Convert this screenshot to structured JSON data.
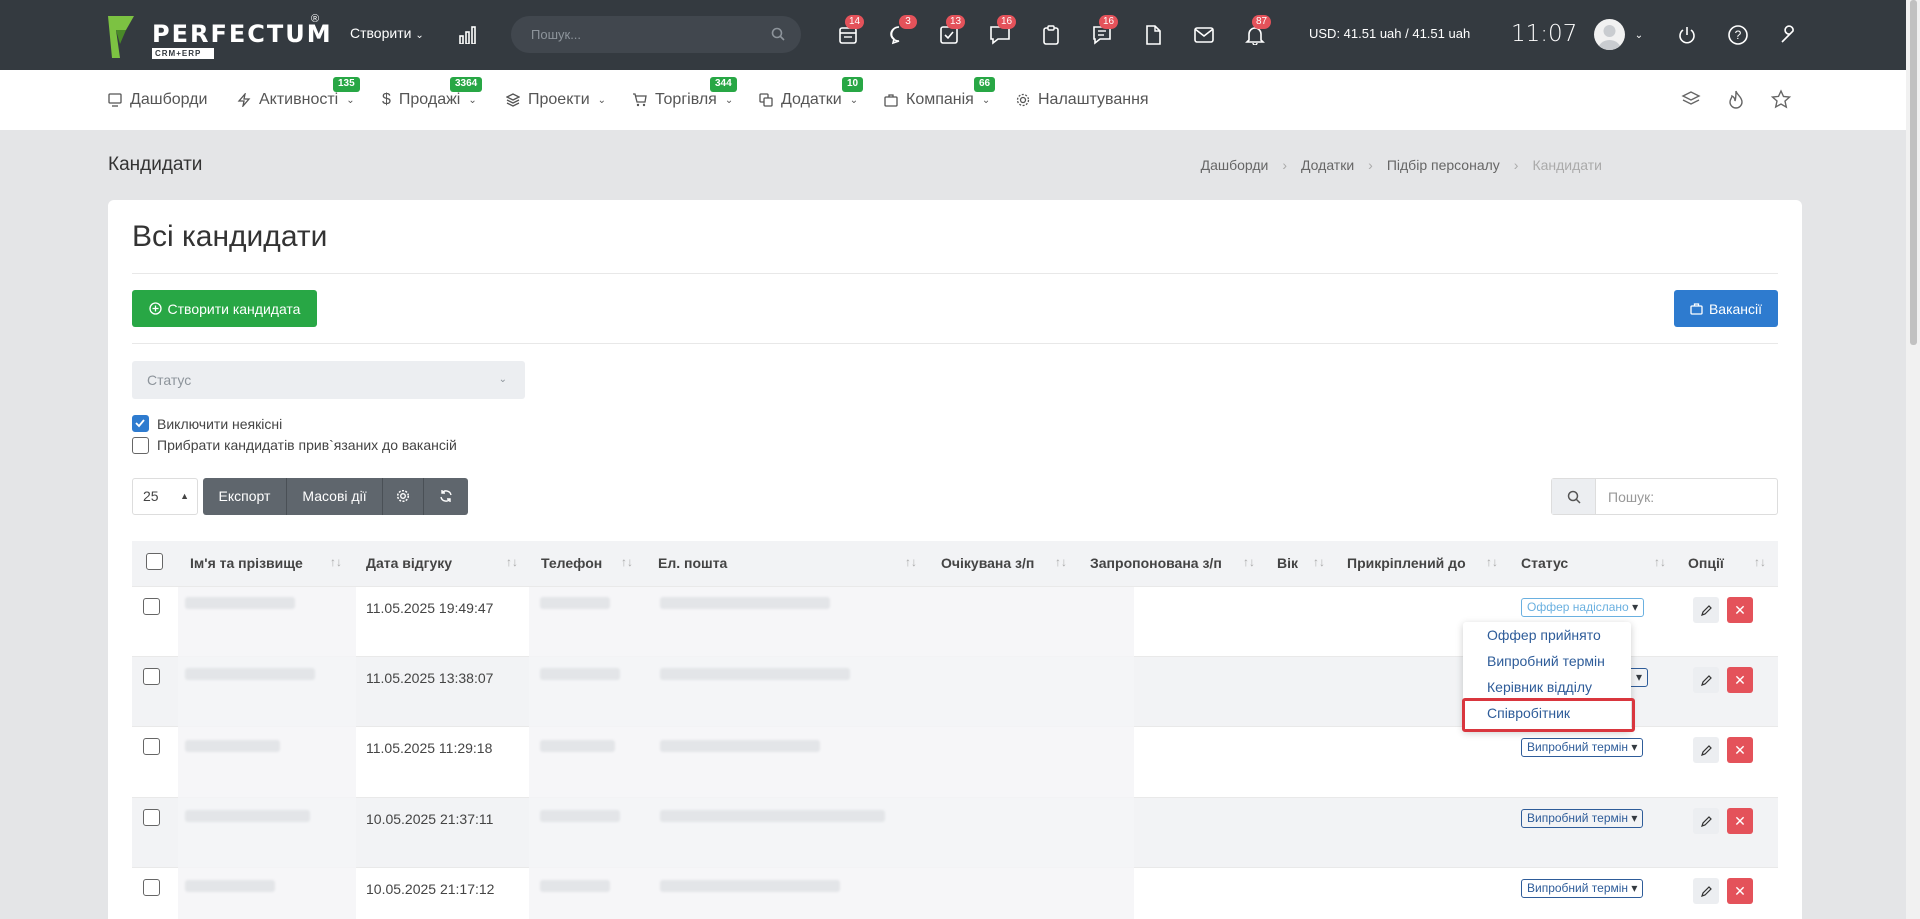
{
  "topbar": {
    "logo": "PERFECTUM",
    "logo_reg": "®",
    "logo_sub": "CRM+ERP",
    "create_label": "Створити",
    "search_placeholder": "Пошук...",
    "badges": {
      "calendar": "14",
      "chat": "3",
      "tasks": "13",
      "messages": "16",
      "clipboard": "",
      "notes": "16",
      "alerts": "87"
    },
    "currency": "USD: 41.51 uah / 41.51 uah",
    "time": "11:07"
  },
  "nav": {
    "items": [
      {
        "label": "Дашборди",
        "badge": ""
      },
      {
        "label": "Активності",
        "badge": "135"
      },
      {
        "label": "Продажі",
        "badge": "3364"
      },
      {
        "label": "Проекти",
        "badge": ""
      },
      {
        "label": "Торгівля",
        "badge": "344"
      },
      {
        "label": "Додатки",
        "badge": "10"
      },
      {
        "label": "Компанія",
        "badge": "66"
      },
      {
        "label": "Налаштування",
        "badge": ""
      }
    ]
  },
  "page": {
    "title": "Кандидати",
    "breadcrumbs": [
      "Дашборди",
      "Додатки",
      "Підбір персоналу",
      "Кандидати"
    ],
    "card_title": "Всі кандидати",
    "create_button": "Створити кандидата",
    "vacancies_button": "Вакансії",
    "status_filter_placeholder": "Статус",
    "checkbox_exclude": "Виключити неякісні",
    "checkbox_remove": "Прибрати кандидатів прив`язаних до вакансій",
    "page_size": "25",
    "export_button": "Експорт",
    "mass_button": "Масові дії",
    "table_search_placeholder": "Пошук:"
  },
  "table": {
    "columns": [
      "Ім'я та прізвище",
      "Дата відгуку",
      "Телефон",
      "Ел. пошта",
      "Очікувана з/п",
      "Запропонована з/п",
      "Вік",
      "Прикріплений до",
      "Статус",
      "Опції"
    ],
    "rows": [
      {
        "date": "11.05.2025 19:49:47",
        "status": "Оффер надіслано"
      },
      {
        "date": "11.05.2025 13:38:07",
        "status": ""
      },
      {
        "date": "11.05.2025 11:29:18",
        "status": "Випробний термін"
      },
      {
        "date": "10.05.2025 21:37:11",
        "status": "Випробний термін"
      },
      {
        "date": "10.05.2025 21:17:12",
        "status": "Випробний термін"
      }
    ]
  },
  "dropdown": {
    "options": [
      "Оффер прийнято",
      "Випробний термін",
      "Керівник відділу",
      "Співробітник"
    ],
    "highlighted": "Співробітник"
  },
  "colors": {
    "topbar": "#343a40",
    "green": "#28a745",
    "blue": "#2e7bcf",
    "red": "#e4525a",
    "highlight": "#d9363e"
  }
}
